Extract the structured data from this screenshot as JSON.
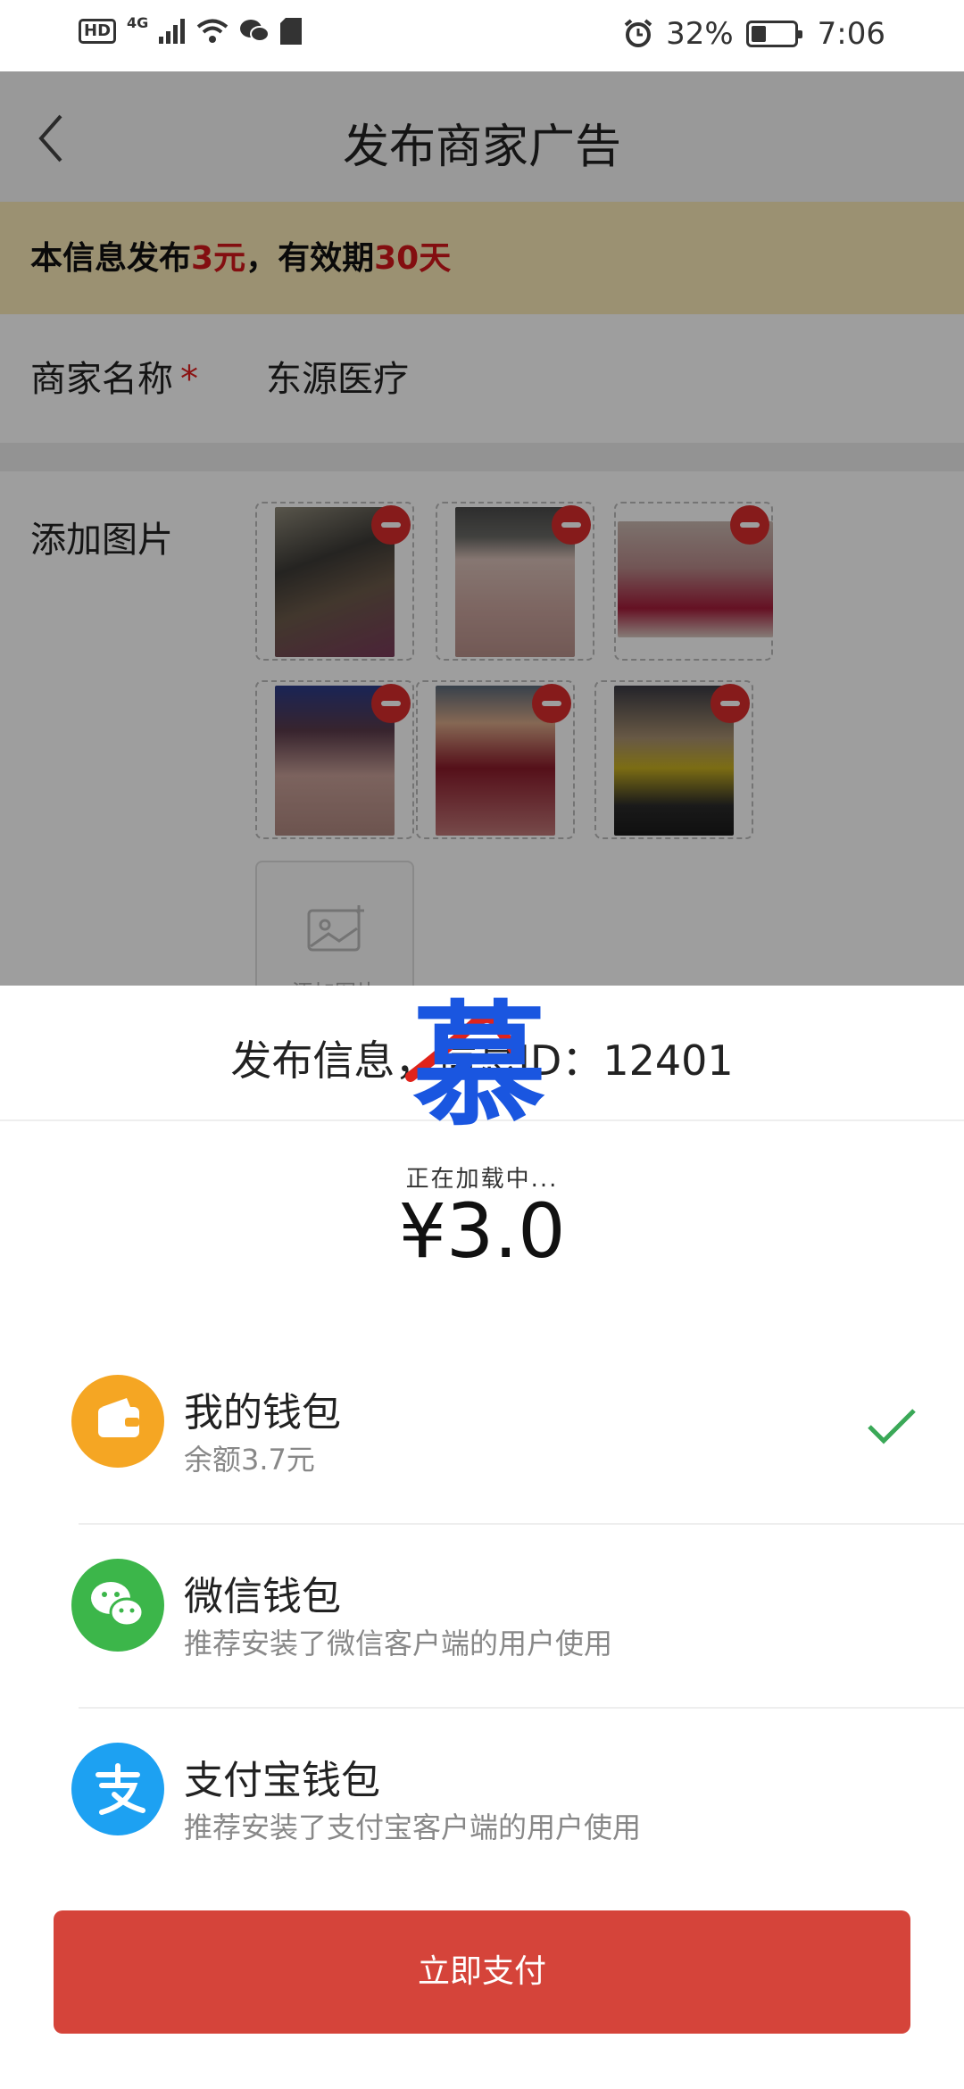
{
  "status_bar": {
    "hd": "HD",
    "network": "4G",
    "battery_percent": "32%",
    "battery_level": 0.32,
    "time": "7:06",
    "icons": [
      "hd-icon",
      "signal-icon",
      "wifi-icon",
      "wechat-notification-icon",
      "sim-icon",
      "alarm-icon",
      "battery-icon"
    ]
  },
  "navbar": {
    "title": "发布商家广告",
    "back_icon": "chevron-left-icon"
  },
  "notice": {
    "part1": "本信息发布",
    "price": "3元",
    "part2": "，有效期",
    "days": "30天",
    "price_color": "#d3181b"
  },
  "merchant": {
    "label": "商家名称",
    "required_mark": "*",
    "value": "东源医疗"
  },
  "images": {
    "label": "添加图片",
    "add_label": "添加图片",
    "thumbnails": [
      "photo-1",
      "photo-2",
      "photo-3",
      "photo-4",
      "photo-5",
      "photo-6"
    ]
  },
  "payment_sheet": {
    "title": "发布信息，信息ID：12401",
    "watermark": "慕",
    "loading": "正在加载中...",
    "amount": "¥3.0",
    "options": [
      {
        "name": "我的钱包",
        "desc": "余额3.7元",
        "icon": "wallet-icon",
        "color": "#f5a623",
        "selected": true
      },
      {
        "name": "微信钱包",
        "desc": "推荐安装了微信客户端的用户使用",
        "icon": "wechat-icon",
        "color": "#3cb64a",
        "selected": false
      },
      {
        "name": "支付宝钱包",
        "desc": "推荐安装了支付宝客户端的用户使用",
        "icon": "alipay-icon",
        "color": "#1da1f2",
        "selected": false
      }
    ],
    "pay_button": "立即支付",
    "button_color": "#d5443a"
  }
}
